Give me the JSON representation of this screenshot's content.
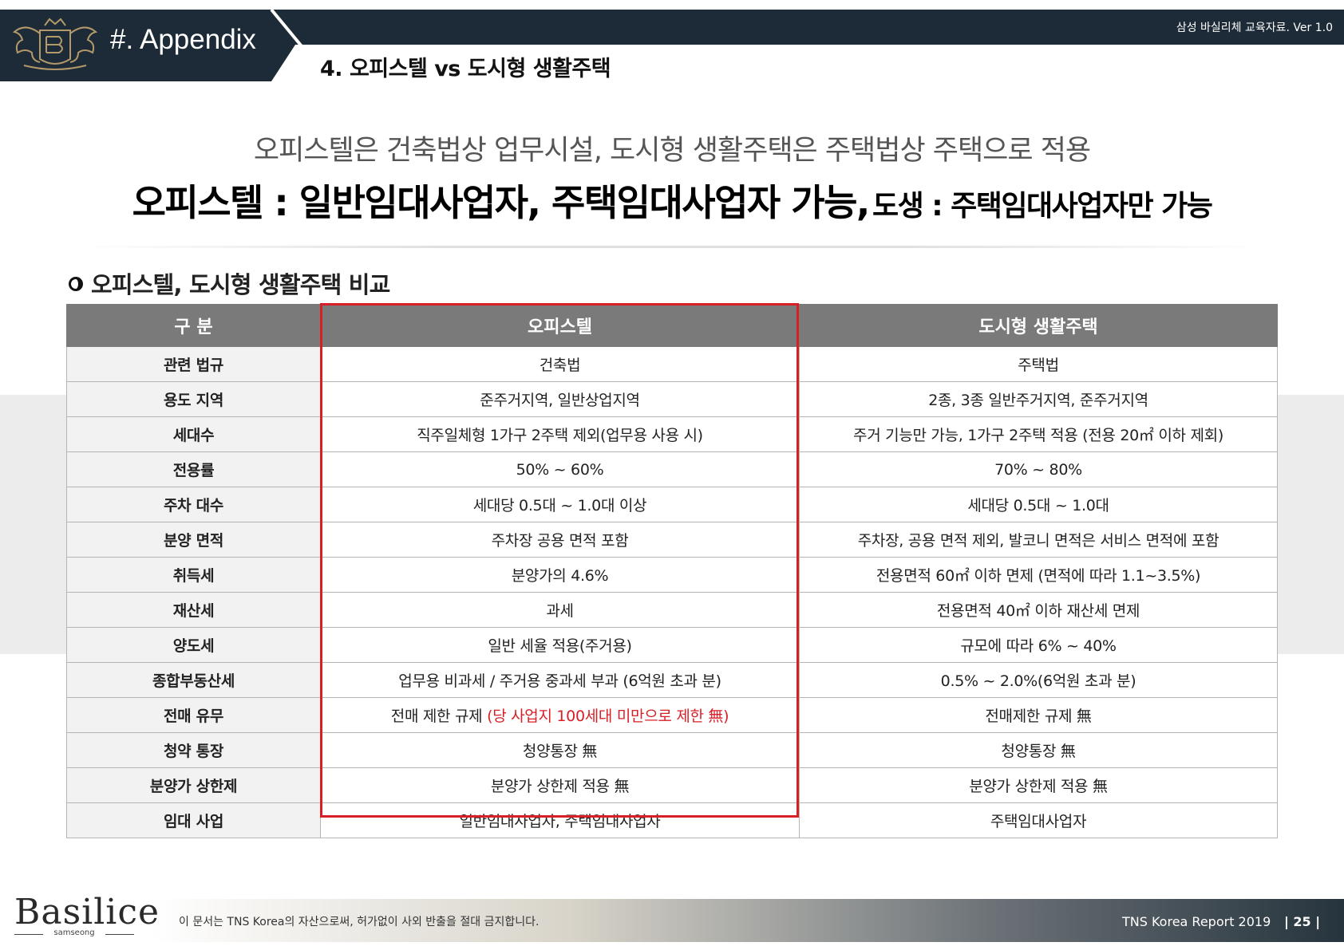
{
  "header": {
    "version": "삼성 바실리체 교육자료. Ver  1.0",
    "appendix_title": "#. Appendix",
    "section_title": "4. 오피스텔 vs 도시형 생활주택"
  },
  "headline": {
    "line1": "오피스텔은 건축법상 업무시설, 도시형 생활주택은 주택법상 주택으로 적용",
    "line2_main": "오피스텔 : 일반임대사업자, 주택임대사업자 가능,",
    "line2_sub": "도생 : 주택임대사업자만 가능"
  },
  "subheading": "오피스텔, 도시형 생활주택 비교",
  "table": {
    "headers": [
      "구 분",
      "오피스텔",
      "도시형 생활주택"
    ],
    "rows": [
      {
        "label": "관련 법규",
        "officetel": "건축법",
        "urban_housing": "주택법"
      },
      {
        "label": "용도 지역",
        "officetel": "준주거지역, 일반상업지역",
        "urban_housing": "2종, 3종 일반주거지역, 준주거지역"
      },
      {
        "label": "세대수",
        "officetel": "직주일체형 1가구 2주택 제외(업무용 사용 시)",
        "urban_housing": "주거 기능만 가능, 1가구 2주택 적용 (전용 20㎡ 이하 제회)"
      },
      {
        "label": "전용률",
        "officetel": "50% ~ 60%",
        "urban_housing": "70% ~ 80%"
      },
      {
        "label": "주차 대수",
        "officetel": "세대당 0.5대 ~ 1.0대 이상",
        "urban_housing": "세대당 0.5대 ~ 1.0대"
      },
      {
        "label": "분양 면적",
        "officetel": "주차장 공용 면적 포함",
        "urban_housing": "주차장, 공용 면적 제외, 발코니 면적은 서비스 면적에 포함"
      },
      {
        "label": "취득세",
        "officetel": "분양가의 4.6%",
        "urban_housing": "전용면적 60㎡ 이하 면제 (면적에 따라 1.1~3.5%)"
      },
      {
        "label": "재산세",
        "officetel": "과세",
        "urban_housing": "전용면적 40㎡ 이하 재산세 면제"
      },
      {
        "label": "양도세",
        "officetel": "일반 세율 적용(주거용)",
        "urban_housing": "규모에 따라 6% ~ 40%"
      },
      {
        "label": "종합부동산세",
        "officetel": "업무용 비과세 / 주거용 중과세 부과 (6억원 초과 분)",
        "urban_housing": "0.5% ~ 2.0%(6억원 초과 분)"
      },
      {
        "label": "전매 유무",
        "officetel": "전매 제한 규제",
        "officetel_note": "(당 사업지 100세대 미만으로 제한 無)",
        "urban_housing": "전매제한 규제 無"
      },
      {
        "label": "청약 통장",
        "officetel": "청양통장 無",
        "urban_housing": "청양통장 無"
      },
      {
        "label": "분양가 상한제",
        "officetel": "분양가 상한제 적용 無",
        "urban_housing": "분양가 상한제 적용 無"
      },
      {
        "label": "임대 사업",
        "officetel": "일반임대사업자, 주택임대사업자",
        "urban_housing": "주택임대사업자"
      }
    ]
  },
  "footer": {
    "brand": "Basilice",
    "brand_sub": "samseong",
    "disclaimer": "이 문서는 TNS Korea의 자산으로써, 허가없이 사외 반출을 절대 금지합니다.",
    "report": "TNS Korea Report 2019",
    "page": "|  25  |"
  },
  "colors": {
    "navy": "#1c2b37",
    "table_header": "#7a7a7a",
    "highlight": "#d81f26"
  },
  "icons": [
    "crest-logo",
    "circle-bullet-icon"
  ]
}
